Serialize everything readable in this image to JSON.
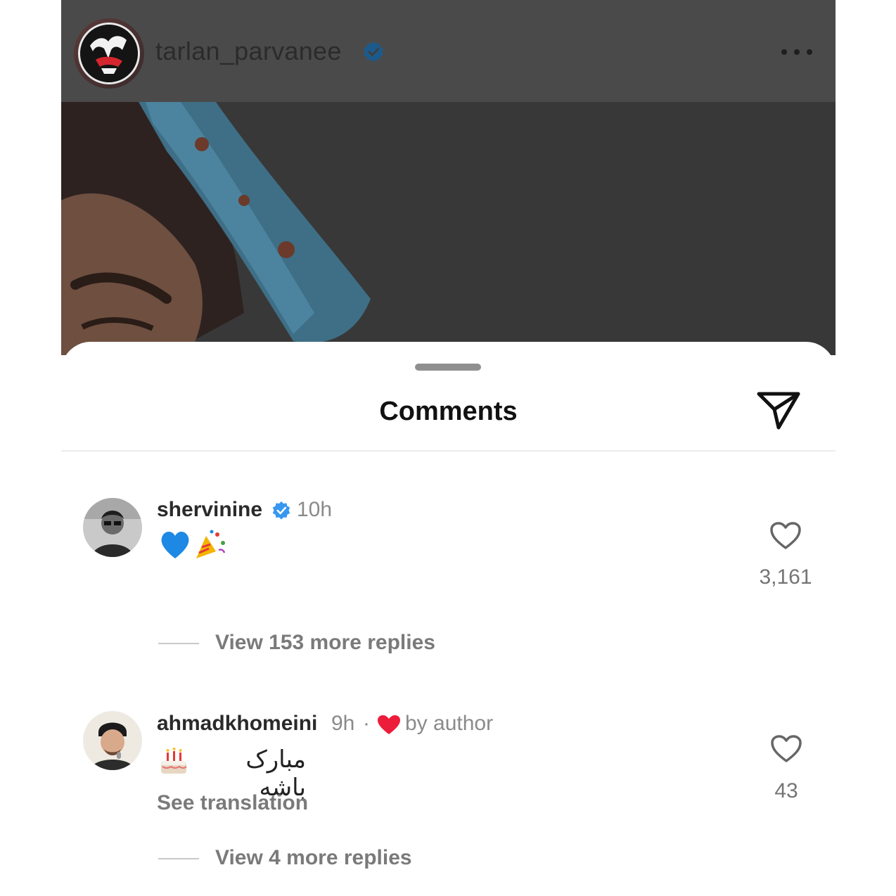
{
  "post": {
    "username": "tarlan_parvanee",
    "verified": true
  },
  "comments_sheet": {
    "title": "Comments"
  },
  "comments": [
    {
      "username": "shervinine",
      "verified": true,
      "time": "10h",
      "text": "",
      "emojis": "💙🎉",
      "likes": "3,161",
      "view_replies": "View 153 more replies"
    },
    {
      "username": "ahmadkhomeini",
      "verified": false,
      "time": "9h",
      "separator": "·",
      "by_author": "by author",
      "text": "مبارک باشه",
      "emojis": "🎂",
      "see_translation": "See translation",
      "likes": "43",
      "view_replies": "View 4 more replies"
    }
  ],
  "colors": {
    "verified_blue": "#3897f0",
    "heart_red": "#ed1c3b",
    "muted_text": "#8a8a8a"
  }
}
